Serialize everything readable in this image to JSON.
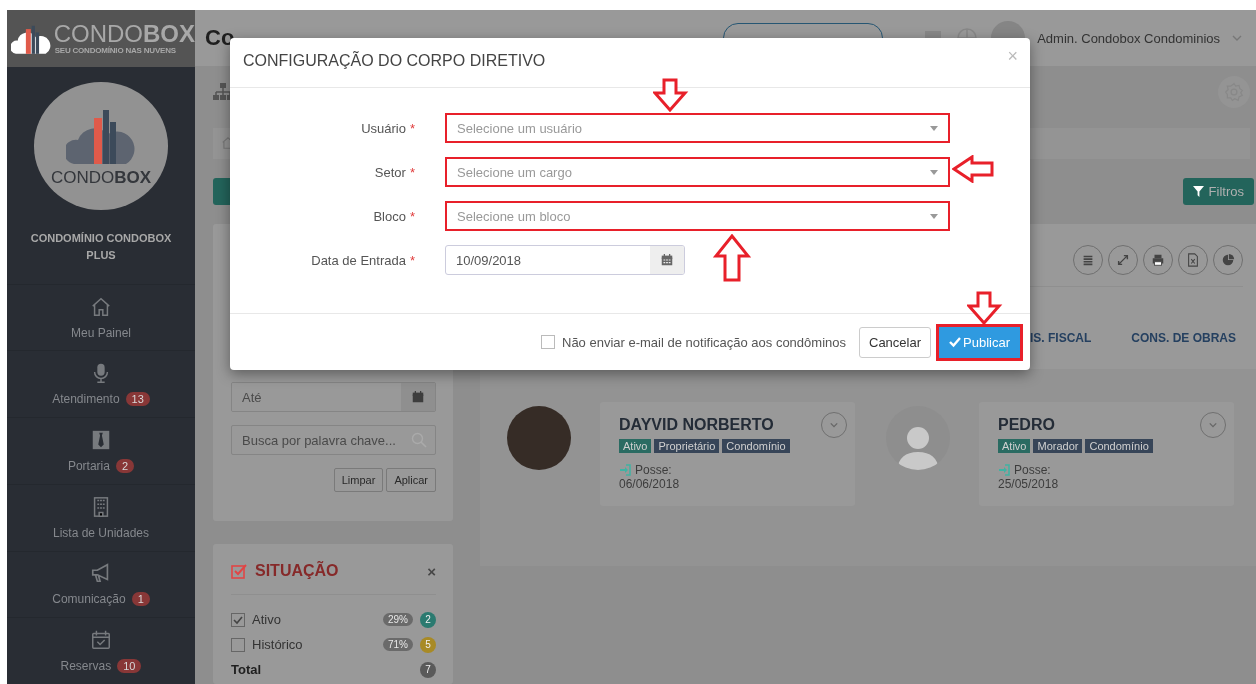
{
  "brand": {
    "logo": "CONDO**BOX**",
    "tagline": "SEU CONDOMÍNIO NAS NUVENS"
  },
  "topbar": {
    "title": "Co",
    "user": "Admin. Condobox Condominios"
  },
  "sidebar": {
    "logo": "CONDO**BOX**",
    "condo_name": "CONDOMÍNIO CONDOBOX PLUS",
    "items": [
      {
        "label": "Meu Painel",
        "kind": "home"
      },
      {
        "label": "Atendimento",
        "kind": "mic",
        "badge": "13"
      },
      {
        "label": "Portaria",
        "kind": "tie",
        "badge": "2"
      },
      {
        "label": "Lista de Unidades",
        "kind": "building"
      },
      {
        "label": "Comunicação",
        "kind": "megaphone",
        "badge": "1"
      },
      {
        "label": "Reservas",
        "kind": "calendar",
        "badge": "10"
      }
    ]
  },
  "filters_button": "Filtros",
  "filter_card": {
    "date_to_placeholder": "Até",
    "search_placeholder": "Busca por palavra chave...",
    "buttons": [
      "Limpar",
      "Aplicar"
    ]
  },
  "situacao": {
    "title": "SITUAÇÃO",
    "close": "×",
    "items": [
      {
        "label": "Ativo",
        "checked": true,
        "percent": "29%",
        "count": "2",
        "color": "#2b7a70"
      },
      {
        "label": "Histórico",
        "checked": false,
        "percent": "71%",
        "count": "5",
        "color": "#a88a26"
      }
    ],
    "total": {
      "label": "Total",
      "count": "7"
    }
  },
  "tabs": [
    {
      "label": "IS. FISCAL"
    },
    {
      "label": "CONS. DE OBRAS"
    }
  ],
  "timeline": [
    {
      "name": "DAYVID NORBERTO",
      "avatar": {
        "kind": "photo"
      },
      "tags": [
        {
          "label": "Ativo",
          "color": "#2a6b62"
        },
        {
          "label": "Proprietário",
          "color": "#374558"
        },
        {
          "label": "Condomínio",
          "color": "#374558"
        }
      ],
      "posse_label": "Posse:",
      "date": "06/06/2018"
    },
    {
      "name": "PEDRO",
      "avatar": {
        "kind": "silhouette"
      },
      "tags": [
        {
          "label": "Ativo",
          "color": "#2a6b62"
        },
        {
          "label": "Morador",
          "color": "#374558"
        },
        {
          "label": "Condomínio",
          "color": "#374558"
        }
      ],
      "posse_label": "Posse:",
      "date": "25/05/2018"
    }
  ],
  "modal": {
    "title": "CONFIGURAÇÃO DO CORPO DIRETIVO",
    "close": "×",
    "fields": [
      {
        "label": "Usuário",
        "required_mark": "*",
        "kind": "select",
        "placeholder": "Selecione um usuário",
        "highlighted": true,
        "annotation_arrow": {
          "kind": "down"
        }
      },
      {
        "label": "Setor",
        "required_mark": "*",
        "kind": "select",
        "placeholder": "Selecione um cargo",
        "highlighted": true,
        "annotation_arrow": {
          "kind": "left"
        }
      },
      {
        "label": "Bloco",
        "required_mark": "*",
        "kind": "select",
        "placeholder": "Selecione um bloco",
        "highlighted": true,
        "annotation_arrow": {
          "kind": "up"
        }
      },
      {
        "label": "Data de Entrada",
        "required_mark": "*",
        "kind": "date",
        "value": "10/09/2018",
        "highlighted": false
      }
    ],
    "notify": {
      "label": "Não enviar e-mail de notificação aos condôminos",
      "checked": false
    },
    "cancel": "Cancelar",
    "publish": {
      "label": "Publicar",
      "highlighted": true,
      "annotation_arrow": {
        "kind": "down"
      }
    }
  }
}
